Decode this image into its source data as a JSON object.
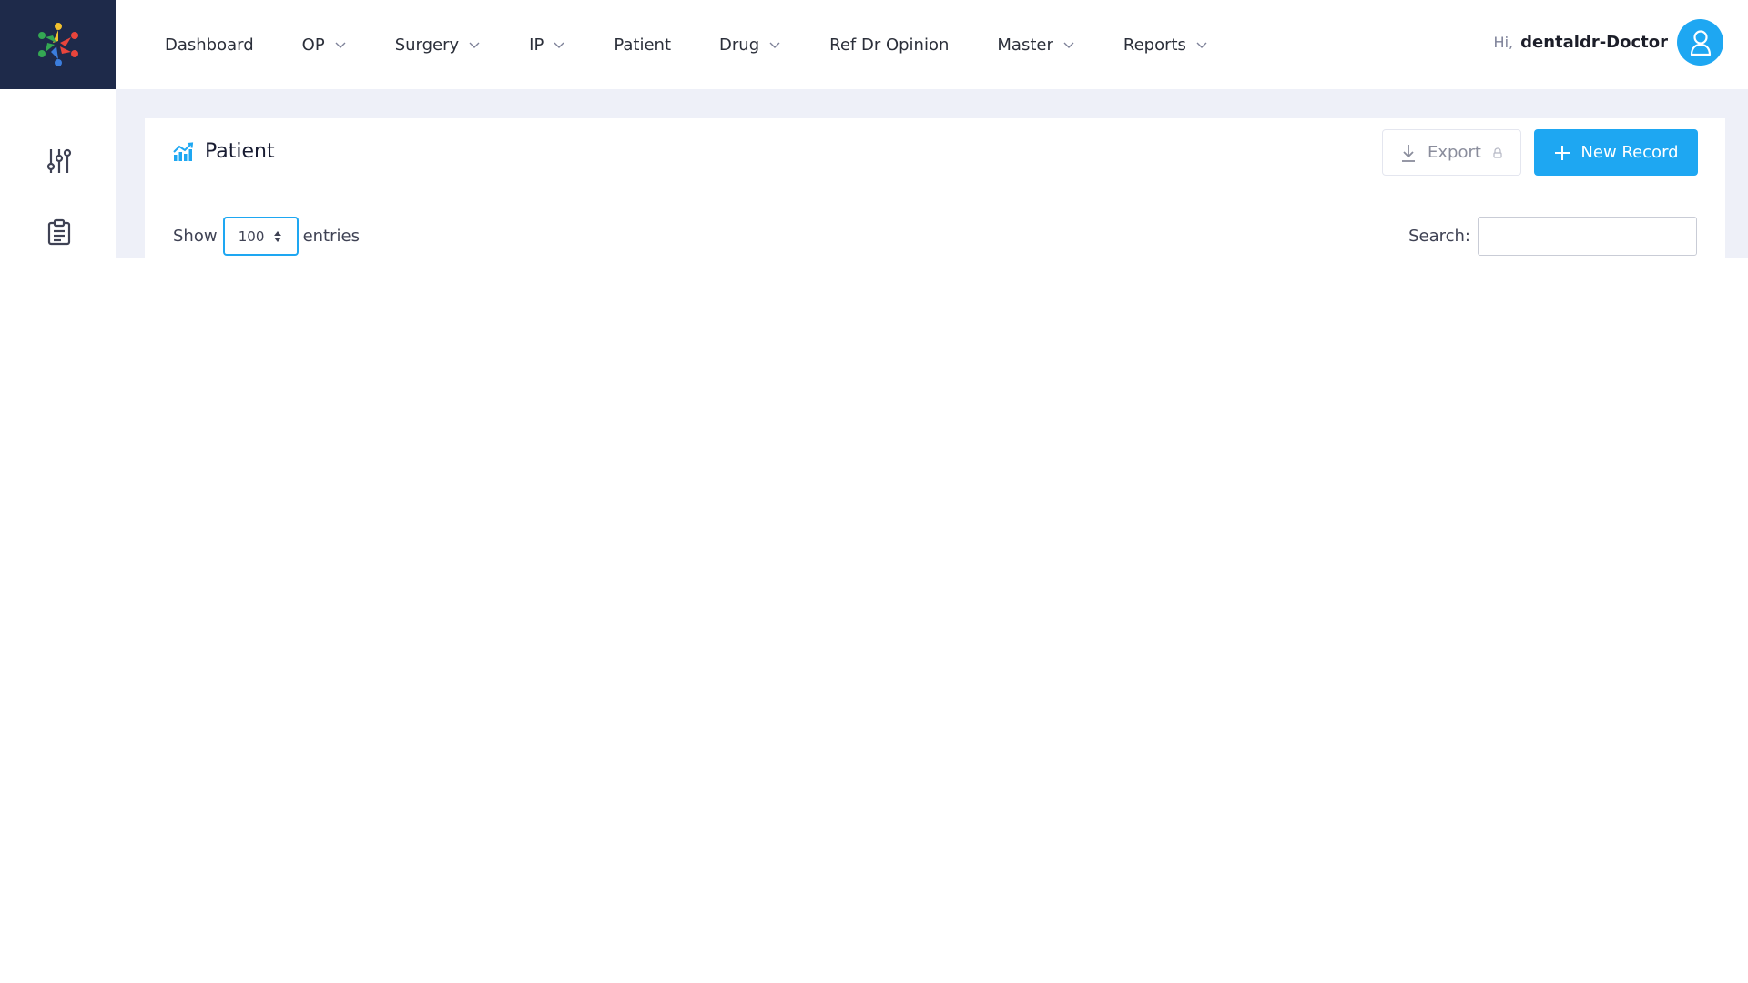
{
  "colors": {
    "logo_bg": "#1e2a4a",
    "accent": "#1ea7f2",
    "content_bg": "#eef0f8"
  },
  "nav": {
    "items": [
      {
        "label": "Dashboard",
        "has_dropdown": false
      },
      {
        "label": "OP",
        "has_dropdown": true
      },
      {
        "label": "Surgery",
        "has_dropdown": true
      },
      {
        "label": "IP",
        "has_dropdown": true
      },
      {
        "label": "Patient",
        "has_dropdown": false
      },
      {
        "label": "Drug",
        "has_dropdown": true
      },
      {
        "label": "Ref Dr Opinion",
        "has_dropdown": false
      },
      {
        "label": "Master",
        "has_dropdown": true
      },
      {
        "label": "Reports",
        "has_dropdown": true
      }
    ]
  },
  "user": {
    "greeting": "Hi,",
    "name": "dentaldr-Doctor",
    "avatar_icon": "user-icon"
  },
  "aside": {
    "icons": [
      "sliders-icon",
      "clipboard-icon"
    ]
  },
  "card": {
    "title": "Patient",
    "title_icon": "chart-line-icon",
    "export_label": "Export",
    "new_record_label": "New Record"
  },
  "table_controls": {
    "show_label": "Show",
    "page_length": "100",
    "entries_label": "entries",
    "search_label": "Search:",
    "search_value": ""
  }
}
